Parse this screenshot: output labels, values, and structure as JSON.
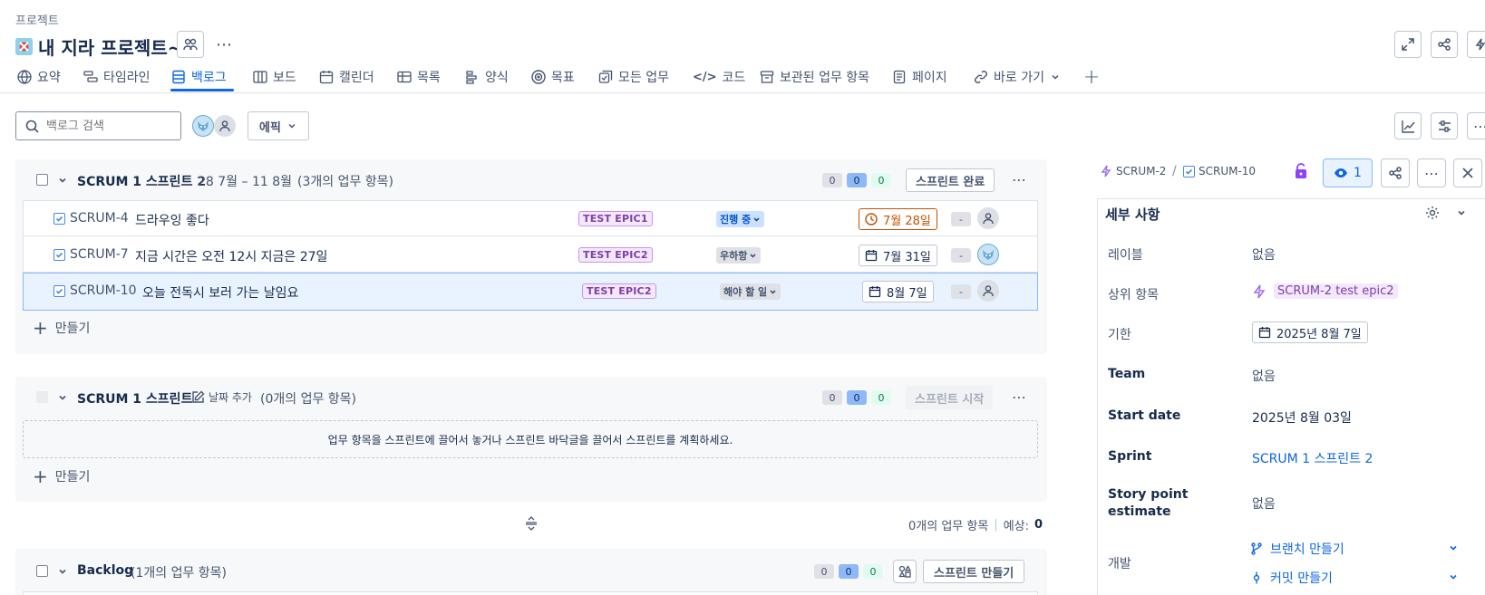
{
  "breadcrumb": "프로젝트",
  "project": {
    "title": "내 지라 프로젝트~"
  },
  "tabs": [
    {
      "label": "요약",
      "icon": "globe-icon"
    },
    {
      "label": "타임라인",
      "icon": "timeline-icon"
    },
    {
      "label": "백로그",
      "icon": "backlog-icon",
      "active": true
    },
    {
      "label": "보드",
      "icon": "board-icon"
    },
    {
      "label": "캘린더",
      "icon": "calendar-icon"
    },
    {
      "label": "목록",
      "icon": "list-icon"
    },
    {
      "label": "양식",
      "icon": "form-icon"
    },
    {
      "label": "목표",
      "icon": "goal-icon"
    },
    {
      "label": "모든 업무",
      "icon": "all-work-icon"
    },
    {
      "label": "코드",
      "icon": "code-icon"
    },
    {
      "label": "보관된 업무 항목",
      "icon": "archive-icon"
    },
    {
      "label": "페이지",
      "icon": "page-icon"
    },
    {
      "label": "바로 가기",
      "icon": "link-icon"
    }
  ],
  "toolbar": {
    "search_placeholder": "백로그 검색",
    "epic_filter": "에픽"
  },
  "sprint1": {
    "name": "SCRUM 1 스프린트 2",
    "dates": "28 7월 – 11 8월",
    "count_text": "(3개의 업무 항목)",
    "counts": [
      "0",
      "0",
      "0"
    ],
    "action": "스프린트 완료",
    "create": "만들기",
    "issues": [
      {
        "key": "SCRUM-4",
        "summary": "드라우잉 좋다",
        "epic": "TEST EPIC1",
        "status": "진행 중",
        "status_type": "inprogress",
        "due": "7월 28일",
        "overdue": true,
        "points": "-",
        "assignee": "none"
      },
      {
        "key": "SCRUM-7",
        "summary": "지금 시간은 오전 12시 지금은 27일",
        "epic": "TEST EPIC2",
        "status": "우하항",
        "status_type": "todo",
        "due": "7월 31일",
        "overdue": false,
        "points": "-",
        "assignee": "fox"
      },
      {
        "key": "SCRUM-10",
        "summary": "오늘 전독시 보러 가는 날임요",
        "epic": "TEST EPIC2",
        "status": "해야 할 일",
        "status_type": "todo",
        "due": "8월 7일",
        "overdue": false,
        "points": "-",
        "assignee": "none"
      }
    ]
  },
  "sprint2": {
    "name": "SCRUM 1 스프린트",
    "add_date": "날짜 추가",
    "count_text": "(0개의 업무 항목)",
    "counts": [
      "0",
      "0",
      "0"
    ],
    "action": "스프린트 시작",
    "empty_hint": "업무 항목을 스프린트에 끌어서 놓거나 스프린트 바닥글을 끌어서 스프린트를 계획하세요.",
    "create": "만들기"
  },
  "summary_bar": {
    "items_text": "0개의 업무 항목",
    "estimate_label": "예상:",
    "estimate_value": "0"
  },
  "backlog": {
    "name": "Backlog",
    "count_text": "(1개의 업무 항목)",
    "counts": [
      "0",
      "0",
      "0"
    ],
    "action": "스프린트 만들기"
  },
  "detail": {
    "parent_key": "SCRUM-2",
    "issue_key": "SCRUM-10",
    "watch_count": "1",
    "section_title": "세부 사항",
    "fields": {
      "labels": {
        "label": "레이블",
        "value": "없음"
      },
      "parent": {
        "label": "상위 항목",
        "value": "SCRUM-2 test epic2"
      },
      "due": {
        "label": "기한",
        "value": "2025년 8월 7일"
      },
      "team": {
        "label": "Team",
        "value": "없음"
      },
      "start": {
        "label": "Start date",
        "value": "2025년 8월 03일"
      },
      "sprint": {
        "label": "Sprint",
        "value": "SCRUM 1 스프린트 2"
      },
      "story": {
        "label": "Story point estimate",
        "value": "없음"
      },
      "dev": {
        "label": "개발",
        "branch": "브랜치 만들기",
        "commit": "커밋 만들기"
      }
    }
  },
  "colors": {
    "accent": "#0c66e4",
    "epic": "#803fa5",
    "overdue": "#c25100",
    "card_bg": "#f7f8f9"
  }
}
